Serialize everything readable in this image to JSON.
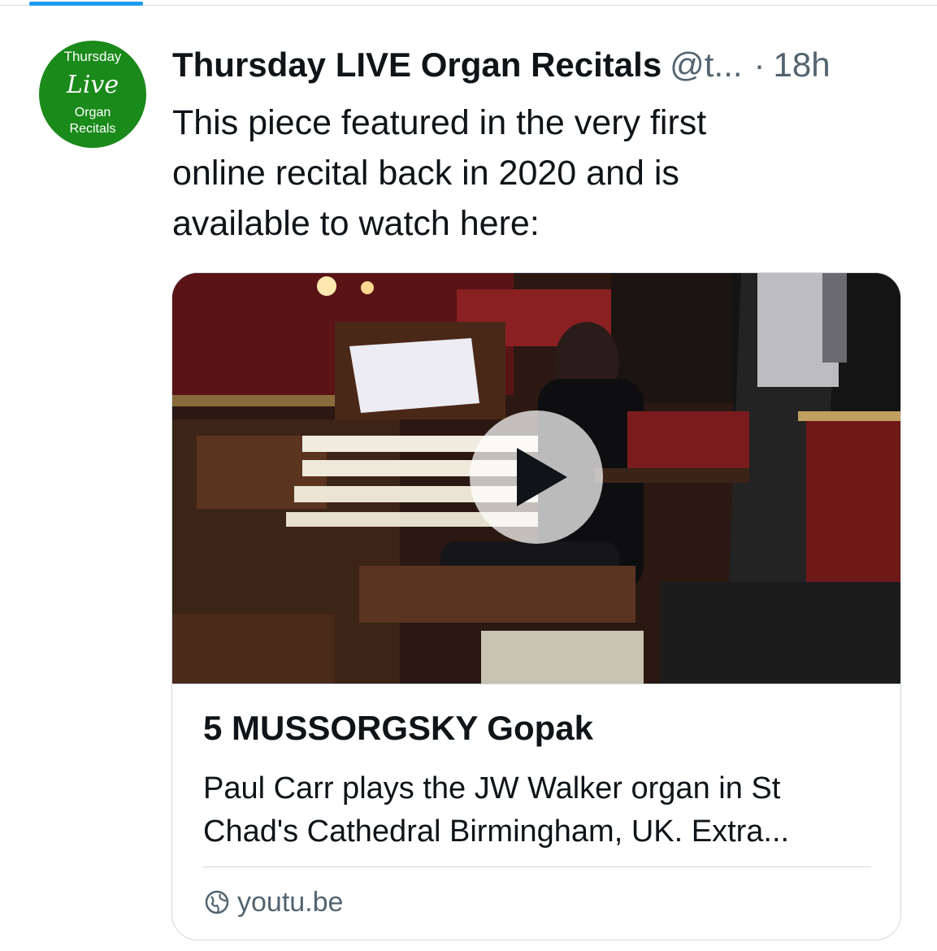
{
  "colors": {
    "accent": "#1d9bf0",
    "text_primary": "#0f1419",
    "text_secondary": "#536471",
    "avatar_green": "#1a8a1a",
    "border": "#cfd9de"
  },
  "avatar": {
    "line1": "Thursday",
    "line2": "Live",
    "line3": "Organ",
    "line4": "Recitals"
  },
  "post": {
    "display_name": "Thursday LIVE Organ Recitals",
    "handle": "@t...",
    "separator": "·",
    "time": "18h",
    "text_lines": [
      "This piece featured in the very first",
      "online recital back in 2020 and is",
      "available to watch here:"
    ]
  },
  "card": {
    "media_icon": "play-icon",
    "title": "5 MUSSORGSKY Gopak",
    "description_lines": [
      "Paul Carr plays the JW Walker organ in St",
      "Chad's Cathedral Birmingham, UK. Extra..."
    ],
    "domain_icon": "globe-icon",
    "domain": "youtu.be"
  }
}
